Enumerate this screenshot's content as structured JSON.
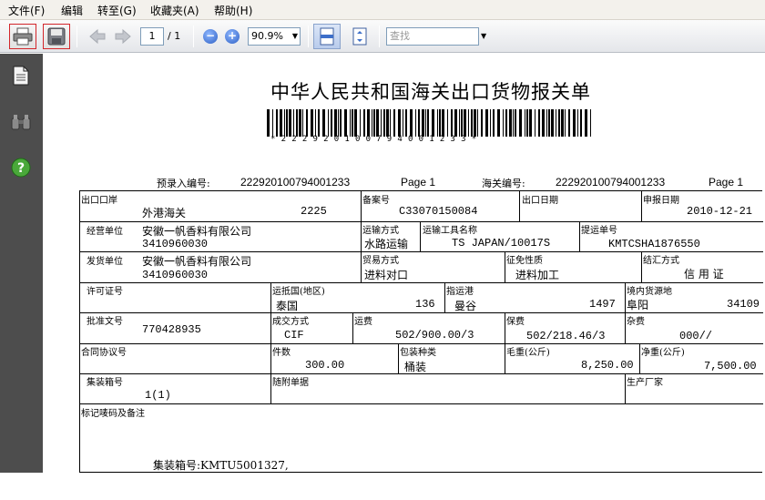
{
  "menu": [
    "文件(F)",
    "编辑",
    "转至(G)",
    "收藏夹(A)",
    "帮助(H)"
  ],
  "toolbar": {
    "page_current": "1",
    "page_total": "/ 1",
    "zoom": "90.9%",
    "find_placeholder": "查找"
  },
  "doc": {
    "title": "中华人民共和国海关出口货物报关单",
    "barcode_text": "*222920100794001233*",
    "pre_entry_label": "预录入编号:",
    "pre_entry_value": "222920100794001233",
    "page_label_1": "Page 1",
    "customs_no_label": "海关编号:",
    "customs_no_value": "222920100794001233",
    "page_label_2": "Page 1"
  },
  "form": {
    "export_port_label": "出口口岸",
    "export_port_value": "外港海关",
    "export_port_code": "2225",
    "record_no_label": "备案号",
    "record_no_value": "C33070150084",
    "export_date_label": "出口日期",
    "declare_date_label": "申报日期",
    "declare_date_value": "2010-12-21",
    "operator_label": "经营单位",
    "operator_name": "安徽一帆香料有限公司",
    "operator_code": "3410960030",
    "transport_mode_label": "运输方式",
    "transport_mode_value": "水路运输",
    "vehicle_label": "运输工具名称",
    "vehicle_value": "TS JAPAN/10017S",
    "bill_no_label": "提运单号",
    "bill_no_value": "KMTCSHA1876550",
    "shipper_label": "发货单位",
    "shipper_name": "安徽一帆香料有限公司",
    "shipper_code": "3410960030",
    "trade_mode_label": "贸易方式",
    "trade_mode_value": "进料对口",
    "tax_nature_label": "征免性质",
    "tax_nature_value": "进料加工",
    "settlement_label": "结汇方式",
    "settlement_value": "信 用 证",
    "license_label": "许可证号",
    "dest_country_label": "运抵国(地区)",
    "dest_country_value": "泰国",
    "dest_country_code": "136",
    "dest_port_label": "指运港",
    "dest_port_value": "曼谷",
    "dest_port_code": "1497",
    "source_label": "境内货源地",
    "source_value": "阜阳",
    "source_code": "34109",
    "approval_label": "批准文号",
    "approval_value": "770428935",
    "deal_mode_label": "成交方式",
    "deal_mode_value": "CIF",
    "freight_label": "运费",
    "freight_value": "502/900.00/3",
    "insurance_label": "保费",
    "insurance_value": "502/218.46/3",
    "misc_label": "杂费",
    "misc_value": "000//",
    "contract_label": "合同协议号",
    "pieces_label": "件数",
    "pieces_value": "300.00",
    "package_label": "包装种类",
    "package_value": "桶装",
    "gross_label": "毛重(公斤)",
    "gross_value": "8,250.00",
    "net_label": "净重(公斤)",
    "net_value": "7,500.00",
    "container_label": "集装箱号",
    "container_value": "1(1)",
    "docs_label": "随附单据",
    "maker_label": "生产厂家",
    "marks_label": "标记唛码及备注",
    "marks_value": "集装箱号:KMTU5001327,"
  }
}
